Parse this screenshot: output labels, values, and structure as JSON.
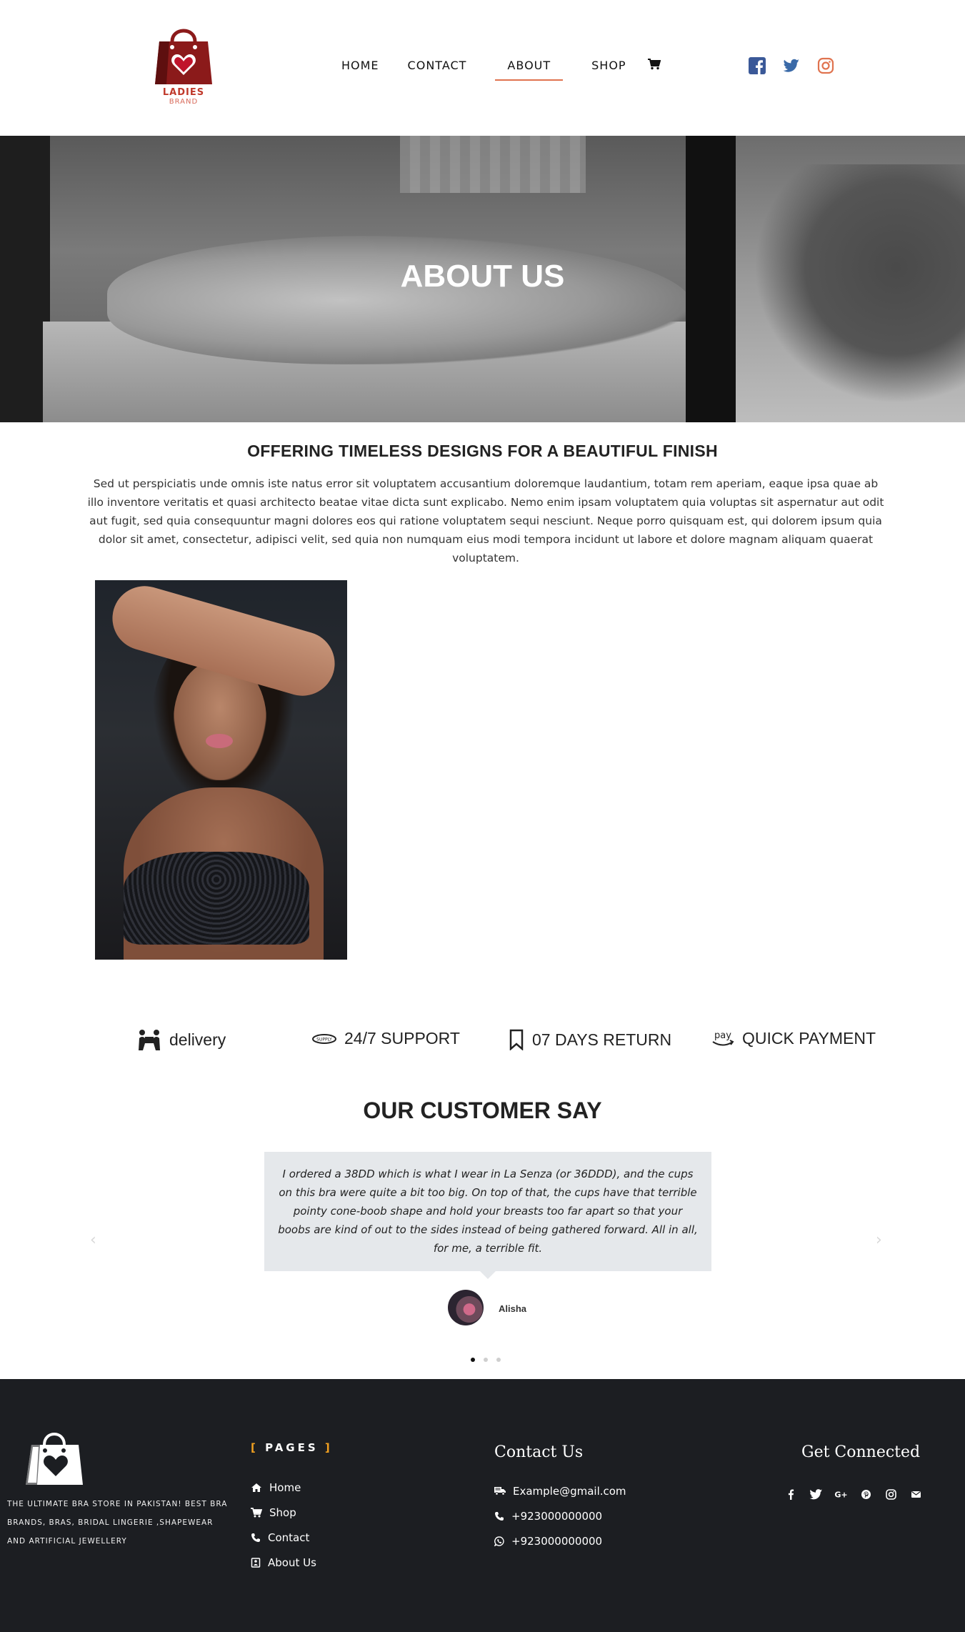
{
  "header": {
    "logo": {
      "brand": "LADIES",
      "sub": "BRAND",
      "icon": "shopping-bag-heart-icon"
    },
    "nav": [
      {
        "label": "HOME",
        "active": false
      },
      {
        "label": "CONTACT",
        "active": false
      },
      {
        "label": "ABOUT",
        "active": true
      },
      {
        "label": "SHOP",
        "active": false
      }
    ],
    "cart_icon": "cart-icon",
    "social": [
      {
        "icon": "facebook-icon",
        "color": "#3b5998"
      },
      {
        "icon": "twitter-icon",
        "color": "#3a6aa8"
      },
      {
        "icon": "instagram-icon",
        "color": "#e0734f"
      }
    ]
  },
  "hero": {
    "title": "ABOUT US"
  },
  "intro": {
    "title": "OFFERING TIMELESS DESIGNS FOR A BEAUTIFUL FINISH",
    "text": "Sed ut perspiciatis unde omnis iste natus error sit voluptatem accusantium doloremque laudantium, totam rem aperiam, eaque ipsa quae ab illo inventore veritatis et quasi architecto beatae vitae dicta sunt explicabo. Nemo enim ipsam voluptatem quia voluptas sit aspernatur aut odit aut fugit, sed quia consequuntur magni dolores eos qui ratione voluptatem sequi nesciunt. Neque porro quisquam est, qui dolorem ipsum quia dolor sit amet, consectetur, adipisci velit, sed quia non numquam eius modi tempora incidunt ut labore et dolore magnam aliquam quaerat voluptatem."
  },
  "features": [
    {
      "label": "delivery",
      "icon": "delivery-icon"
    },
    {
      "label": "24/7 SUPPORT",
      "icon": "support-icon"
    },
    {
      "label": "07 DAYS RETURN",
      "icon": "bookmark-icon"
    },
    {
      "label": "QUICK PAYMENT",
      "icon": "pay-icon"
    }
  ],
  "testimonials": {
    "title": "OUR CUSTOMER SAY",
    "quote": "I ordered a 38DD which is what I wear in La Senza (or 36DDD), and the cups on this bra were quite a bit too big. On top of that, the cups have that terrible pointy cone-boob shape and hold your breasts too far apart so that your boobs are kind of out to the sides instead of being gathered forward. All in all, for me, a terrible fit.",
    "author": "Alisha",
    "prev_icon": "chevron-left-icon",
    "next_icon": "chevron-right-icon",
    "active_slide": 1,
    "total_slides": 3
  },
  "footer": {
    "tagline": "THE ULTIMATE BRA STORE IN PAKISTAN! BEST BRA BRANDS, BRAS, BRIDAL LINGERIE ,SHAPEWEAR AND ARTIFICIAL JEWELLERY",
    "pages_title": "PAGES",
    "pages": [
      {
        "label": "Home",
        "icon": "home-icon"
      },
      {
        "label": "Shop",
        "icon": "cart-icon"
      },
      {
        "label": "Contact",
        "icon": "phone-icon"
      },
      {
        "label": "About Us",
        "icon": "about-icon"
      }
    ],
    "contact_title": "Contact Us",
    "contact": [
      {
        "label": "Example@gmail.com",
        "icon": "email-truck-icon"
      },
      {
        "label": "+923000000000",
        "icon": "phone-icon"
      },
      {
        "label": "+923000000000",
        "icon": "whatsapp-icon"
      }
    ],
    "connect_title": "Get Connected",
    "social": [
      "facebook-icon",
      "twitter-icon",
      "google-plus-icon",
      "pinterest-icon",
      "instagram-icon",
      "email-icon"
    ]
  }
}
